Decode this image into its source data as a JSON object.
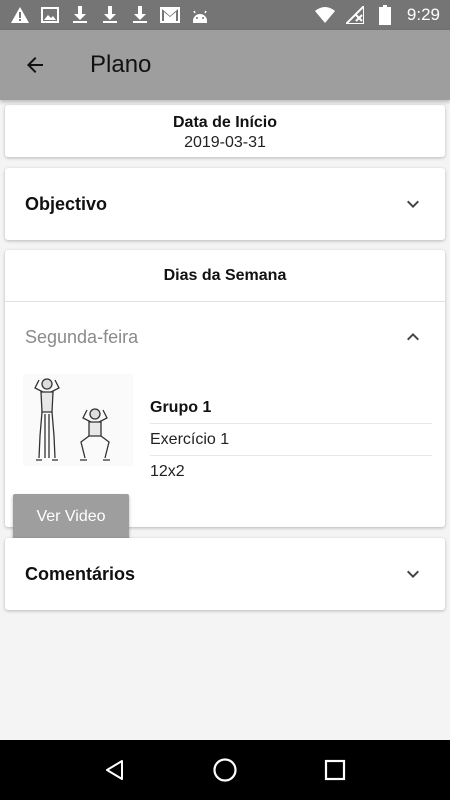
{
  "status_bar": {
    "time": "9:29",
    "left_icons": [
      "warning-icon",
      "image-icon",
      "download-icon",
      "download-icon",
      "download-icon",
      "gmail-icon",
      "android-icon"
    ],
    "right_icons": [
      "wifi-icon",
      "no-signal-icon",
      "battery-icon"
    ]
  },
  "app_bar": {
    "title": "Plano",
    "back_icon": "arrow-left-icon",
    "color": "#9e9e9e"
  },
  "start_date": {
    "label": "Data de Início",
    "value": "2019-03-31"
  },
  "objectivo": {
    "label": "Objectivo",
    "state": "collapsed"
  },
  "dias_semana": {
    "title": "Dias da Semana",
    "day": {
      "label": "Segunda-feira",
      "state": "expanded",
      "exercise": {
        "image": "squat-exercise-illustration",
        "video_button": "Ver Video",
        "group": "Grupo 1",
        "name": "Exercício 1",
        "reps": "12x2"
      }
    }
  },
  "comentarios": {
    "label": "Comentários",
    "state": "collapsed"
  },
  "nav_bar": {
    "buttons": [
      "back-triangle-icon",
      "home-circle-icon",
      "recents-square-icon"
    ]
  }
}
